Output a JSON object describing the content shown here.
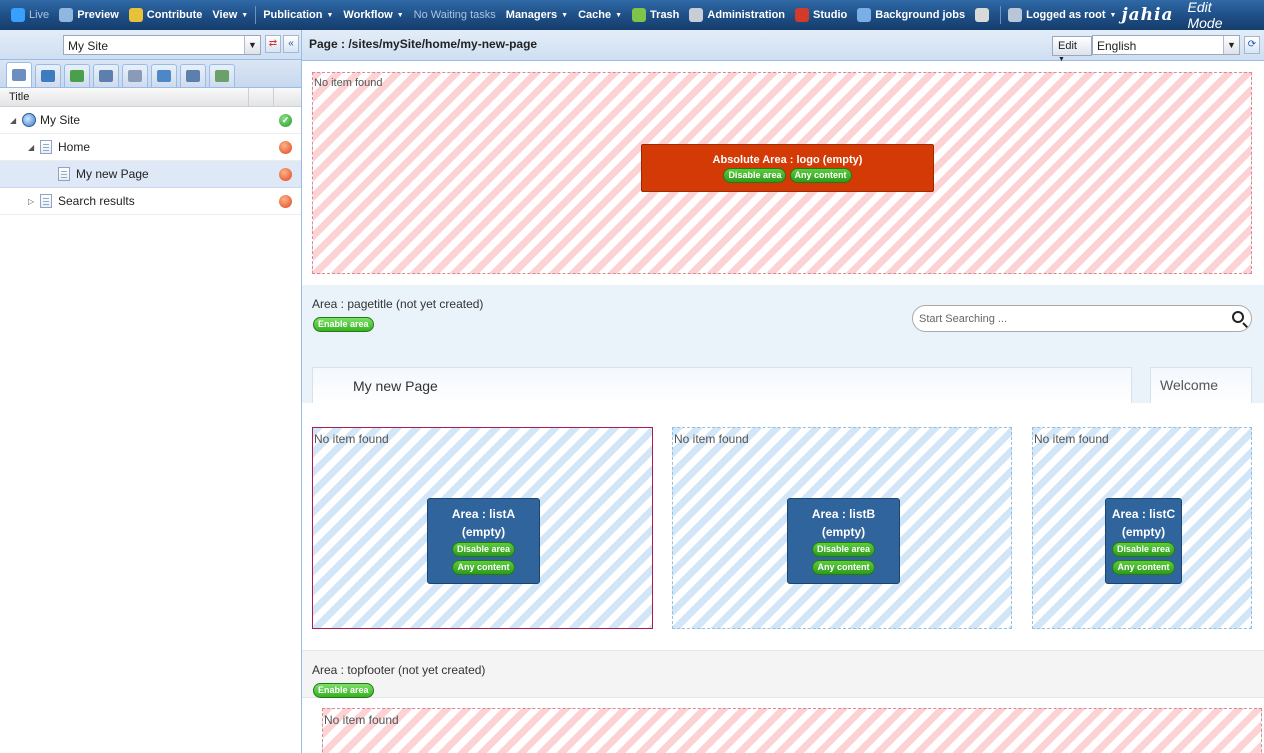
{
  "topbar": {
    "items": [
      {
        "label": "Live",
        "dim": true,
        "caret": false,
        "icon": "live-icon",
        "color": "#3aa0ff"
      },
      {
        "label": "Preview",
        "dim": false,
        "caret": false,
        "icon": "preview-icon",
        "color": "#8fb7e0"
      },
      {
        "label": "Contribute",
        "dim": false,
        "caret": false,
        "icon": "contribute-icon",
        "color": "#e8c13a"
      },
      {
        "label": "View",
        "dim": false,
        "caret": true,
        "icon": "",
        "color": ""
      },
      {
        "label": "Publication",
        "dim": false,
        "caret": true,
        "icon": "",
        "color": "",
        "sep_before": true
      },
      {
        "label": "Workflow",
        "dim": false,
        "caret": true,
        "icon": "",
        "color": ""
      },
      {
        "label": "No Waiting tasks",
        "dim": true,
        "caret": false,
        "icon": "",
        "color": ""
      },
      {
        "label": "Managers",
        "dim": false,
        "caret": true,
        "icon": "",
        "color": ""
      },
      {
        "label": "Cache",
        "dim": false,
        "caret": true,
        "icon": "",
        "color": ""
      },
      {
        "label": "Trash",
        "dim": false,
        "caret": false,
        "icon": "trash-icon",
        "color": "#7ec44a"
      },
      {
        "label": "Administration",
        "dim": false,
        "caret": false,
        "icon": "wrench-icon",
        "color": "#c9ced6"
      },
      {
        "label": "Studio",
        "dim": false,
        "caret": false,
        "icon": "studio-icon",
        "color": "#d23a2a"
      },
      {
        "label": "Background jobs",
        "dim": false,
        "caret": false,
        "icon": "background-jobs-icon",
        "color": "#7aaee6"
      },
      {
        "label": "",
        "dim": false,
        "caret": false,
        "icon": "clipboard-icon",
        "color": "#d9d9d9"
      },
      {
        "label": "Logged as root",
        "dim": false,
        "caret": true,
        "icon": "user-icon",
        "color": "#b8c6d8",
        "sep_before": true
      }
    ],
    "brand": "jahia",
    "mode": "Edit Mode"
  },
  "left": {
    "site_select": "My Site",
    "tabs": [
      "content-tree-icon",
      "users-icon",
      "refresh-content-icon",
      "pages-icon",
      "categories-icon",
      "search-icon",
      "hierarchy-icon",
      "list-icon"
    ],
    "column_title": "Title",
    "tree": [
      {
        "label": "My Site",
        "depth": 0,
        "expanded": true,
        "type": "site",
        "status": "ok"
      },
      {
        "label": "Home",
        "depth": 1,
        "expanded": true,
        "type": "page",
        "status": "warn"
      },
      {
        "label": "My new Page",
        "depth": 2,
        "expanded": null,
        "type": "page",
        "status": "warn",
        "selected": true
      },
      {
        "label": "Search results",
        "depth": 1,
        "expanded": false,
        "type": "page",
        "status": "warn"
      }
    ]
  },
  "main": {
    "page_path": "Page : /sites/mySite/home/my-new-page",
    "edit_label": "Edit",
    "language": "English",
    "no_item": "No item found",
    "logo_area": {
      "title": "Absolute Area : logo (empty)",
      "disable": "Disable area",
      "any": "Any content"
    },
    "pagetitle": {
      "title": "Area : pagetitle (not yet created)",
      "enable": "Enable area"
    },
    "search_placeholder": "Start Searching ...",
    "nav": {
      "page_tab": "My new Page",
      "welcome": "Welcome"
    },
    "lists": [
      {
        "title1": "Area : listA",
        "title2": "(empty)",
        "disable": "Disable area",
        "any": "Any content",
        "selected": true
      },
      {
        "title1": "Area : listB",
        "title2": "(empty)",
        "disable": "Disable area",
        "any": "Any content",
        "selected": false
      },
      {
        "title1": "Area : listC",
        "title2": "(empty)",
        "disable": "Disable area",
        "any": "Any content",
        "selected": false
      }
    ],
    "topfooter": {
      "title": "Area : topfooter (not yet created)",
      "enable": "Enable area"
    }
  }
}
